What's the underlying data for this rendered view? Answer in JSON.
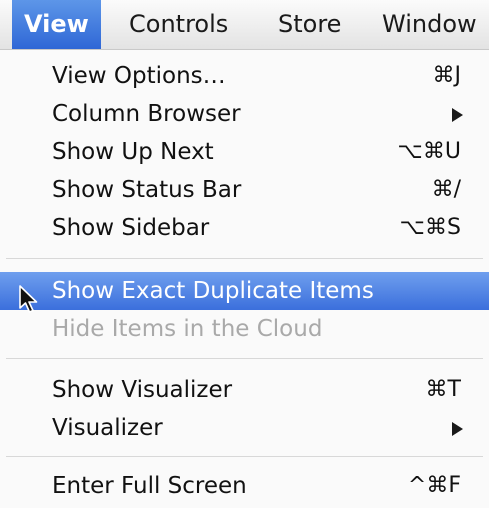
{
  "menubar": {
    "items": [
      "View",
      "Controls",
      "Store",
      "Window"
    ]
  },
  "menu": {
    "group1": [
      {
        "label": "View Options…",
        "shortcut": "⌘J"
      },
      {
        "label": "Column Browser",
        "submenu": true
      },
      {
        "label": "Show Up Next",
        "shortcut": "⌥⌘U"
      },
      {
        "label": "Show Status Bar",
        "shortcut": "⌘/"
      },
      {
        "label": "Show Sidebar",
        "shortcut": "⌥⌘S"
      }
    ],
    "group2": [
      {
        "label": "Show Exact Duplicate Items",
        "state": "highlighted"
      },
      {
        "label": "Hide Items in the Cloud",
        "state": "disabled"
      }
    ],
    "group3": [
      {
        "label": "Show Visualizer",
        "shortcut": "⌘T"
      },
      {
        "label": "Visualizer",
        "submenu": true
      }
    ],
    "group4": [
      {
        "label": "Enter Full Screen",
        "shortcut": "^⌘F"
      }
    ]
  },
  "colors": {
    "highlight": "#3b6fdc",
    "disabled_text": "#a9a9a9"
  },
  "icons": {
    "cursor": "arrow-cursor-icon",
    "submenu": "chevron-right-icon"
  }
}
